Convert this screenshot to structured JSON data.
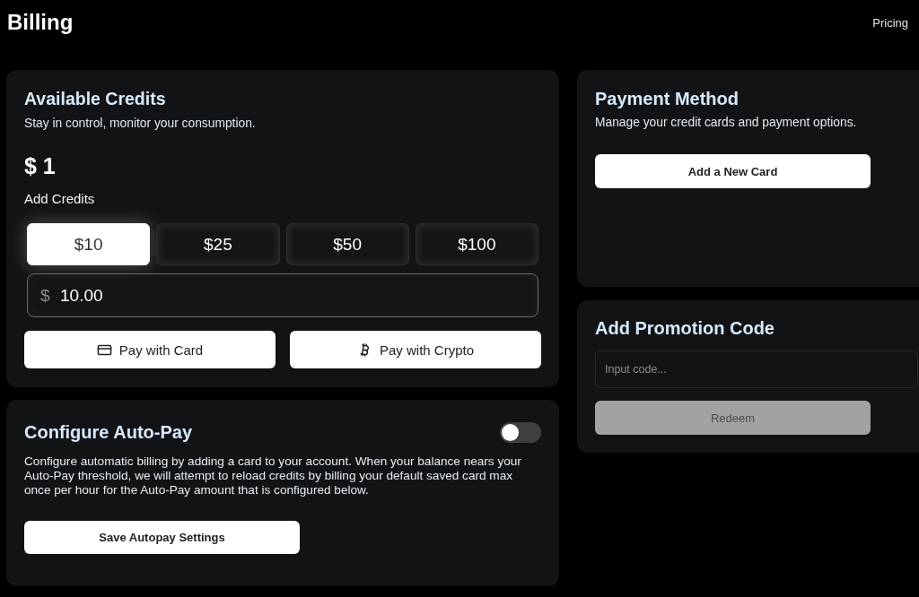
{
  "header": {
    "title": "Billing",
    "nav_link": "Pricing"
  },
  "credits_card": {
    "title": "Available Credits",
    "subtitle": "Stay in control, monitor your consumption.",
    "balance": "$ 1",
    "add_label": "Add Credits",
    "amounts": [
      {
        "label": "$10",
        "selected": true
      },
      {
        "label": "$25",
        "selected": false
      },
      {
        "label": "$50",
        "selected": false
      },
      {
        "label": "$100",
        "selected": false
      }
    ],
    "amount_input": {
      "prefix": "$",
      "value": "10.00"
    },
    "pay_buttons": [
      {
        "label": "Pay with Card",
        "kind": "card"
      },
      {
        "label": "Pay with Crypto",
        "kind": "crypto"
      }
    ]
  },
  "autopay_card": {
    "title": "Configure Auto-Pay",
    "on": false,
    "description": "Configure automatic billing by adding a card to your account. When your balance nears your Auto-Pay threshold, we will attempt to reload credits by billing your default saved card max once per hour for the Auto-Pay amount that is configured below.",
    "button": "Save Autopay Settings"
  },
  "payment_card": {
    "title": "Payment Method",
    "subtitle": "Manage your credit cards and payment options.",
    "button": "Add a New Card"
  },
  "promo_card": {
    "title": "Add Promotion Code",
    "placeholder": "Input code...",
    "button": {
      "label": "Redeem",
      "disabled": true
    }
  }
}
